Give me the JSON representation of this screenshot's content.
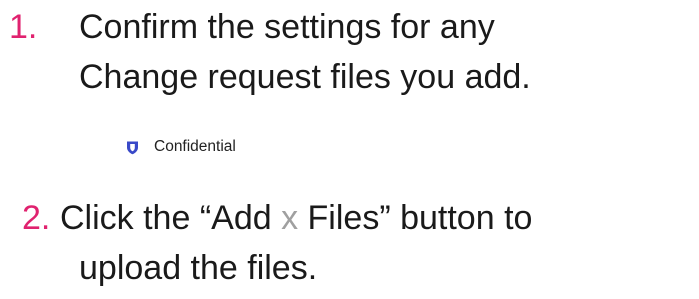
{
  "step1": {
    "number": "1.",
    "line1": "Confirm the settings for any",
    "line2": "Change request files you add."
  },
  "sensitivity_label": {
    "icon": "shield-icon",
    "text": "Confidential",
    "icon_color": "#3949c8"
  },
  "step2": {
    "number": "2.",
    "line1_before": "Click the “Add ",
    "line1_x": "x",
    "line1_after": " Files” button to",
    "line2": "upload the files."
  },
  "colors": {
    "step_number": "#e0226f",
    "x_placeholder": "#a0a0a0"
  }
}
